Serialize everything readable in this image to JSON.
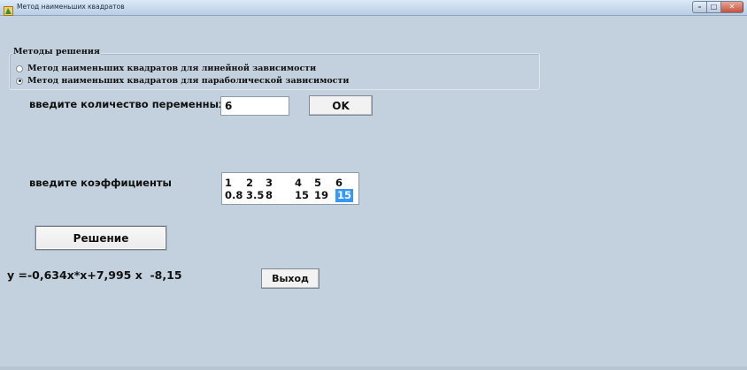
{
  "window": {
    "title": "Метод наименьших квадратов"
  },
  "methods_group": {
    "caption": "Методы решения",
    "options": [
      {
        "label": "Метод наименьших квадратов для линейной зависимости",
        "checked": false
      },
      {
        "label": "Метод наименьших квадратов для параболической зависимости",
        "checked": true
      }
    ]
  },
  "variables": {
    "label": "введите количество переменных",
    "value": "6",
    "ok_label": "OK"
  },
  "coefficients": {
    "label": "введите коэффициенты",
    "rows": [
      [
        "1",
        "2",
        "3",
        "4",
        "5",
        "6"
      ],
      [
        "0.8",
        "3.5",
        "8",
        "15",
        "19",
        "15"
      ]
    ]
  },
  "solve_label": "Решение",
  "result": "y =-0,634x*x+7,995 x  -8,15",
  "exit_label": "Выход"
}
